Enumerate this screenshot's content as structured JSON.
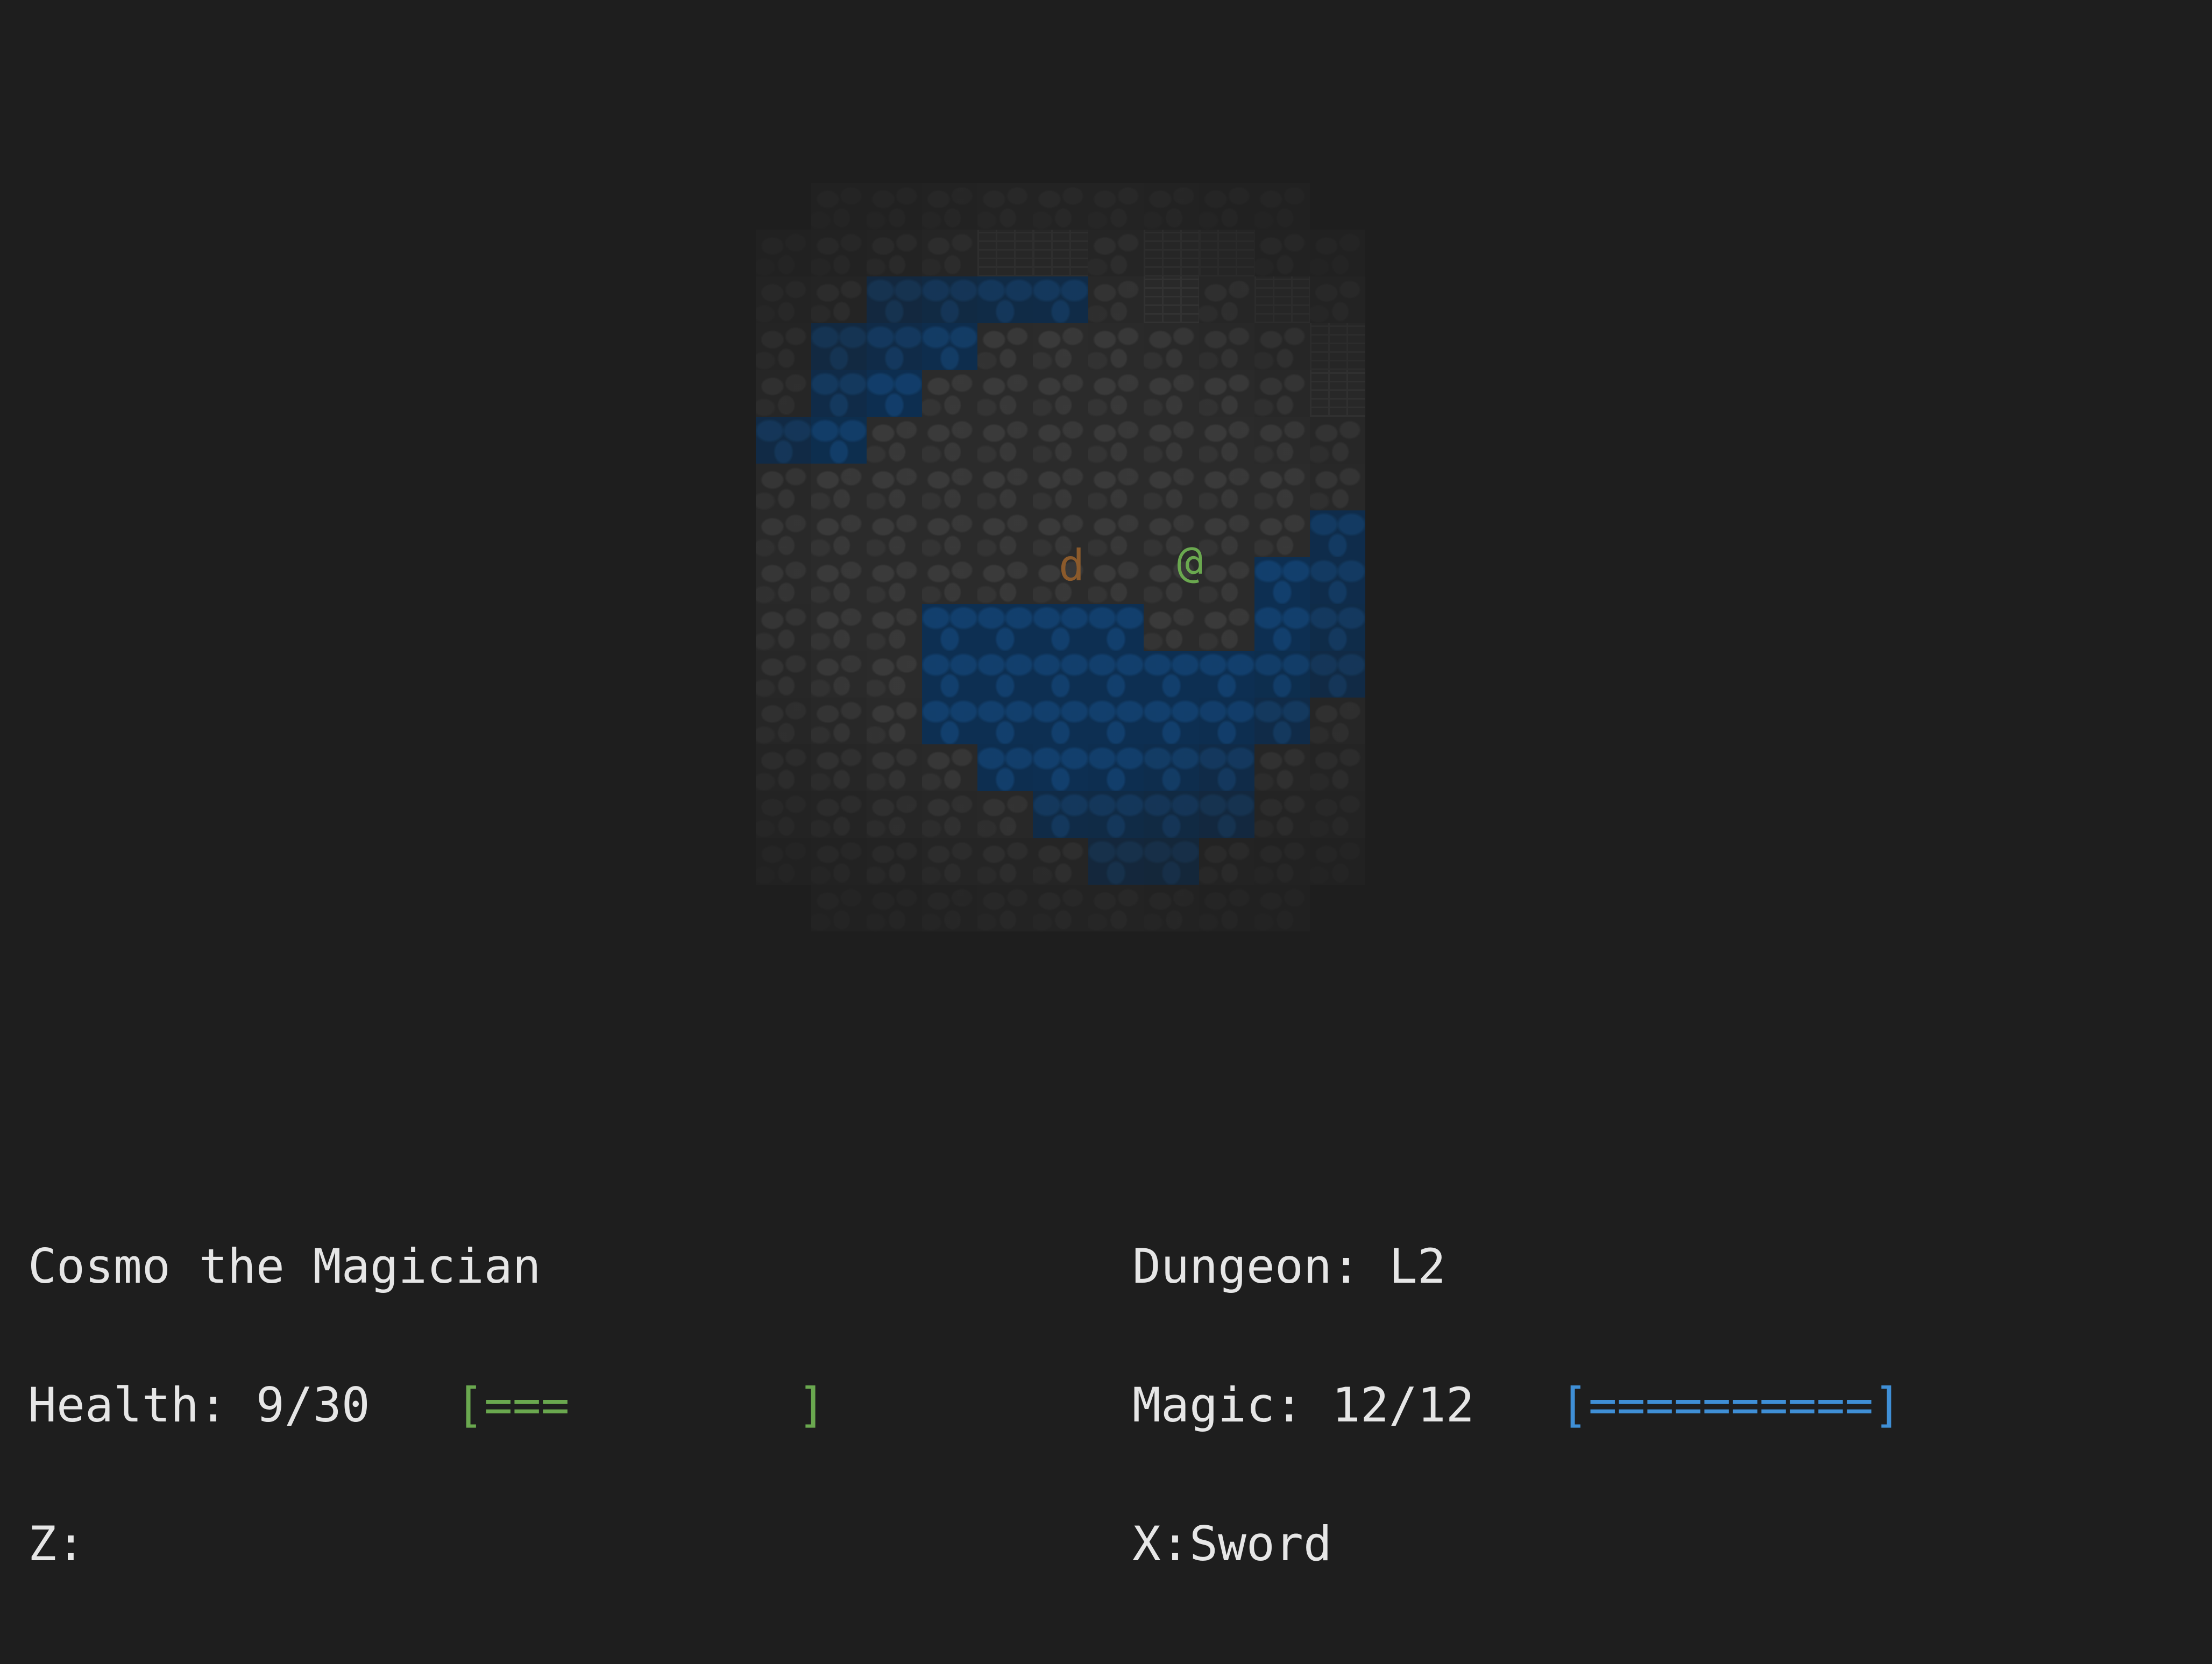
{
  "player": {
    "name": "Cosmo the Magician",
    "glyph": "@",
    "color": "#6aa84f"
  },
  "monster": {
    "glyph": "d",
    "color": "#8b5a2b"
  },
  "stats": {
    "health_label": "Health: 9/30",
    "health_bar": "[===        ]",
    "health_current": 9,
    "health_max": 30,
    "health_color": "#6aa84f",
    "magic_label": "Magic: 12/12",
    "magic_bar": "[==========]",
    "magic_current": 12,
    "magic_max": 12,
    "magic_color": "#3f8fd6"
  },
  "dungeon": {
    "label": "Dungeon: L2"
  },
  "keys": {
    "z_slot": "Z:",
    "x_slot": "X:Sword"
  },
  "map": {
    "tile_legend": {
      ".": "floor",
      "~": "water",
      "#": "wall"
    },
    "rows": [
      "...........",
      "....##.##..",
      "..~~~~.#.#.",
      ".~~~......#",
      ".~~.......#",
      "~~.........",
      "...........",
      "..........~",
      ".........~~",
      "...~~~~..~~",
      "...~~~~~~~~",
      "...~~~~~~~.",
      "....~~~~~..",
      ".....~~~~..",
      "......~~...",
      "..........."
    ]
  }
}
